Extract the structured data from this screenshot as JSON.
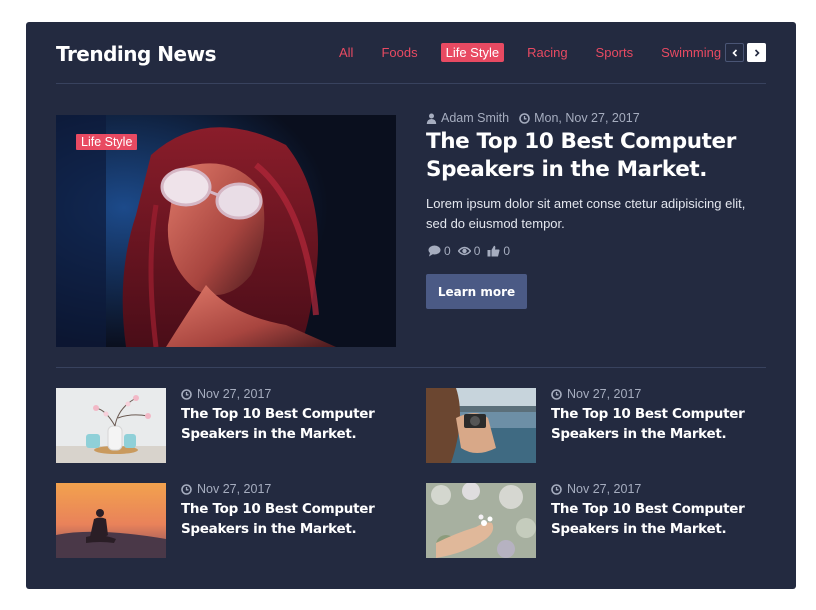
{
  "widget": {
    "title": "Trending News",
    "tabs": [
      {
        "label": "All"
      },
      {
        "label": "Foods"
      },
      {
        "label": "Life Style",
        "active": true
      },
      {
        "label": "Racing"
      },
      {
        "label": "Sports"
      },
      {
        "label": "Swimming"
      },
      {
        "label": "•••"
      }
    ]
  },
  "featured": {
    "badge": "Life Style",
    "author": "Adam Smith",
    "date": "Mon, Nov 27, 2017",
    "title": "The Top 10 Best Computer Speakers in the Market.",
    "description": "Lorem ipsum dolor sit amet conse ctetur adipisicing elit, sed do eiusmod tempor.",
    "comments": "0",
    "views": "0",
    "likes": "0",
    "button_label": "Learn more"
  },
  "posts": [
    {
      "date": "Nov 27, 2017",
      "title": "The Top 10 Best Computer Speakers in the Market."
    },
    {
      "date": "Nov 27, 2017",
      "title": "The Top 10 Best Computer Speakers in the Market."
    },
    {
      "date": "Nov 27, 2017",
      "title": "The Top 10 Best Computer Speakers in the Market."
    },
    {
      "date": "Nov 27, 2017",
      "title": "The Top 10 Best Computer Speakers in the Market."
    }
  ],
  "colors": {
    "panel": "#232a40",
    "accent": "#e84a62",
    "button": "#4b5a85",
    "meta_text": "#a6adbf"
  },
  "icons": {
    "author": "user-icon",
    "date": "clock-icon",
    "comments": "comment-icon",
    "views": "eye-icon",
    "likes": "thumbs-up-icon",
    "prev": "chevron-left-icon",
    "next": "chevron-right-icon"
  }
}
